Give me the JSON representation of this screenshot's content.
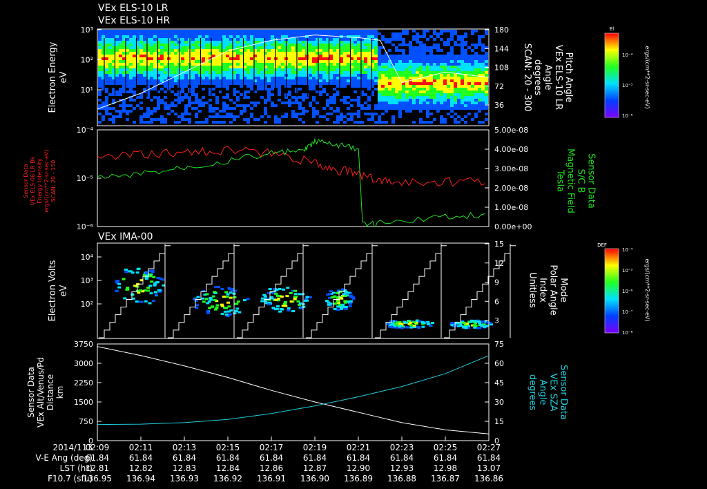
{
  "titles": [
    "VEx ELS-10 LR",
    "VEx ELS-10 HR"
  ],
  "colors": {
    "electron_series": "#ff2020",
    "magnetic_series": "#20e020",
    "sza_series": "#20d0e0",
    "axis": "#ffffff"
  },
  "chart_data": [
    {
      "type": "heatmap",
      "panel": "els",
      "title": "",
      "ylabel": [
        "Electron Energy",
        "eV"
      ],
      "y_scale": "log",
      "ylim": [
        1,
        1000
      ],
      "y_ticks": [
        "10³",
        "10²",
        "10¹"
      ],
      "y2label": [
        "Pitch Angle",
        "VEx ELS-10 LR",
        "Angle",
        "degrees",
        "SCAN: 20 - 300"
      ],
      "y2lim": [
        0,
        180
      ],
      "y2_ticks": [
        "180",
        "144",
        "108",
        "72",
        "36"
      ],
      "pitch_angle_series": {
        "x": [
          "02:09",
          "02:11",
          "02:13",
          "02:15",
          "02:17",
          "02:19",
          "02:21",
          "02:22",
          "02:23",
          "02:25",
          "02:27"
        ],
        "values": [
          30,
          60,
          100,
          140,
          160,
          170,
          165,
          160,
          80,
          100,
          90
        ]
      },
      "colorbar": {
        "label": "El",
        "unit": "ergs/(cm**2-sr-sec-eV)",
        "ticks": [
          "10⁻⁴",
          "10⁻⁵",
          "10⁻⁶"
        ]
      }
    },
    {
      "type": "line",
      "panel": "sensor",
      "y_scale": "log",
      "ylim": [
        1e-06,
        0.0001
      ],
      "y_ticks": [
        "10⁻⁴",
        "10⁻⁵",
        "10⁻⁶"
      ],
      "ylabel": [
        "Sensor Data",
        "VEx ELS-06 LR Bk",
        "Energy Intensity",
        "ergs/(cm**2-sr-sec-eV)",
        "SCAN: 20 - 150"
      ],
      "y2lim": [
        0,
        5e-08
      ],
      "y2_ticks": [
        "5.00e-08",
        "4.00e-08",
        "3.00e-08",
        "2.00e-08",
        "1.00e-08",
        "0.00e+00"
      ],
      "y2label": [
        "Sensor Data",
        "S/C B",
        "Magnetic Field",
        "Tesla"
      ],
      "series": [
        {
          "x_min": [
            0,
            2,
            4,
            6,
            8,
            10,
            11,
            12,
            13,
            14,
            16,
            18
          ],
          "values": [
            2.6e-05,
            3e-05,
            3.4e-05,
            3.8e-05,
            3.2e-05,
            2e-05,
            1.5e-05,
            1.2e-05,
            9e-06,
            8e-06,
            8.5e-06,
            9e-06
          ]
        },
        {
          "x_min": [
            0,
            2,
            4,
            6,
            8,
            9.5,
            10,
            11,
            12,
            12.2,
            13,
            16,
            18
          ],
          "values": [
            2.5e-08,
            2.7e-08,
            3.1e-08,
            3.4e-08,
            3.8e-08,
            3.9e-08,
            4.4e-08,
            4.2e-08,
            4e-08,
            1e-09,
            2e-09,
            5e-09,
            6e-09
          ]
        }
      ]
    },
    {
      "type": "heatmap",
      "panel": "ima",
      "title": "VEx IMA-00",
      "ylabel": [
        "Electron Volts",
        "eV"
      ],
      "y_scale": "log",
      "ylim": [
        10,
        50000
      ],
      "y_ticks": [
        "10⁴",
        "10³",
        "10²"
      ],
      "y2lim": [
        0,
        15
      ],
      "y2_ticks": [
        "15",
        "12",
        "9",
        "6",
        "3"
      ],
      "y2label": [
        "Mode",
        "Polar Angle",
        "Index",
        "Unitless"
      ],
      "colorbar": {
        "label": "DEF",
        "unit": "ergs/(cm**2-sr-sec-eV)",
        "ticks": [
          "10⁻⁴",
          "10⁻⁵",
          "10⁻⁶",
          "10⁻⁷",
          "10⁻⁸"
        ]
      }
    },
    {
      "type": "line",
      "panel": "alt",
      "ylim": [
        0,
        3750
      ],
      "y_ticks": [
        "3750",
        "3000",
        "2250",
        "1500",
        "750",
        "0"
      ],
      "ylabel": [
        "Sensor Data",
        "VEx Alt/Venus/Pd",
        "Distance",
        "km"
      ],
      "y2lim": [
        0,
        75
      ],
      "y2_ticks": [
        "75",
        "60",
        "45",
        "30",
        "15",
        "0"
      ],
      "y2label": [
        "Sensor Data",
        "VEx SZA",
        "Angle",
        "degrees"
      ],
      "series": [
        {
          "x_min": [
            0,
            2,
            4,
            6,
            8,
            10,
            12,
            14,
            16,
            18
          ],
          "values": [
            3650,
            3300,
            2900,
            2450,
            1950,
            1500,
            1100,
            700,
            420,
            260
          ]
        },
        {
          "x_min": [
            0,
            2,
            4,
            6,
            8,
            10,
            12,
            14,
            16,
            18
          ],
          "values": [
            12.5,
            12.8,
            14,
            16.5,
            21,
            27,
            34,
            42,
            52,
            66
          ]
        }
      ]
    }
  ],
  "x_axis": {
    "date_label": "2014/113",
    "ticks": [
      "02:09",
      "02:11",
      "02:13",
      "02:15",
      "02:17",
      "02:19",
      "02:21",
      "02:23",
      "02:25",
      "02:27"
    ],
    "rows": [
      {
        "label": "V-E Ang (deg)",
        "values": [
          "61.84",
          "61.84",
          "61.84",
          "61.84",
          "61.84",
          "61.84",
          "61.84",
          "61.84",
          "61.84",
          "61.84"
        ]
      },
      {
        "label": "LST (hr)",
        "values": [
          "12.81",
          "12.82",
          "12.83",
          "12.84",
          "12.86",
          "12.87",
          "12.90",
          "12.93",
          "12.98",
          "13.07"
        ]
      },
      {
        "label": "F10.7 (sfu)",
        "values": [
          "136.95",
          "136.94",
          "136.93",
          "136.92",
          "136.91",
          "136.90",
          "136.89",
          "136.88",
          "136.87",
          "136.86"
        ]
      }
    ]
  }
}
